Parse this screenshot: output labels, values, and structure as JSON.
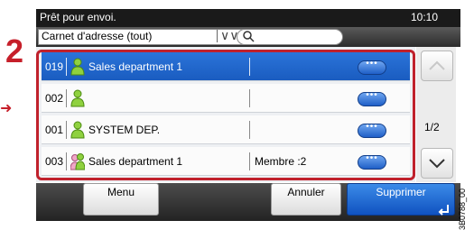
{
  "status": {
    "message": "Prêt pour envoi.",
    "time": "10:10"
  },
  "address_book": {
    "filter_label": "Carnet d'adresse (tout)",
    "search_placeholder": ""
  },
  "step_number": "2",
  "rows": [
    {
      "num": "019",
      "name": "Sales department 1",
      "member": "",
      "type": "person",
      "selected": true
    },
    {
      "num": "002",
      "name": "",
      "member": "",
      "type": "person",
      "selected": false
    },
    {
      "num": "001",
      "name": "SYSTEM DEP.",
      "member": "",
      "type": "person",
      "selected": false
    },
    {
      "num": "003",
      "name": "Sales department 1",
      "member": "Membre :2",
      "type": "group",
      "selected": false
    }
  ],
  "pagination": {
    "label": "1/2"
  },
  "buttons": {
    "menu": "Menu",
    "cancel": "Annuler",
    "delete": "Supprimer"
  },
  "figure_code": "3B0788_00",
  "colors": {
    "accent_red": "#c0212c",
    "selection_blue": "#1a5cc0"
  }
}
